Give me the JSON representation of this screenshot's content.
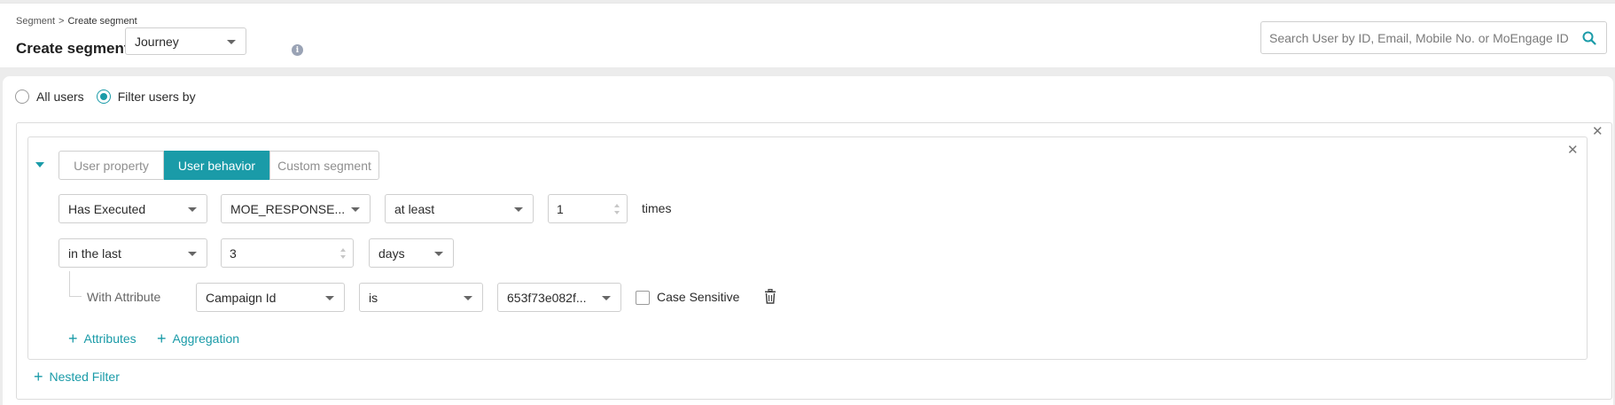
{
  "breadcrumb": {
    "parent": "Segment",
    "separator": ">",
    "current": "Create segment"
  },
  "header": {
    "title": "Create segment for",
    "segment_for_value": "Journey"
  },
  "search": {
    "placeholder": "Search User by ID, Email, Mobile No. or MoEngage ID"
  },
  "audience": {
    "options": [
      {
        "label": "All users",
        "selected": false
      },
      {
        "label": "Filter users by",
        "selected": true
      }
    ]
  },
  "filter": {
    "tabs": [
      {
        "label": "User property",
        "active": false
      },
      {
        "label": "User behavior",
        "active": true
      },
      {
        "label": "Custom segment",
        "active": false
      }
    ],
    "row1": {
      "condition": "Has Executed",
      "event": "MOE_RESPONSE...",
      "operator": "at least",
      "count": "1",
      "suffix": "times"
    },
    "row2": {
      "time_operator": "in the last",
      "amount": "3",
      "unit": "days"
    },
    "attribute_row": {
      "label": "With Attribute",
      "attribute": "Campaign Id",
      "operator": "is",
      "value": "653f73e082f...",
      "case_sensitive_label": "Case Sensitive",
      "case_sensitive": false
    },
    "add_attributes": "Attributes",
    "add_aggregation": "Aggregation"
  },
  "nested_filter": "Nested Filter",
  "colors": {
    "accent": "#1a9ba8",
    "border": "#cfcfcf",
    "background": "#ececec"
  },
  "icons": [
    "info-icon",
    "search-icon",
    "close-icon",
    "caret-down-icon",
    "plus-icon",
    "trash-icon"
  ]
}
